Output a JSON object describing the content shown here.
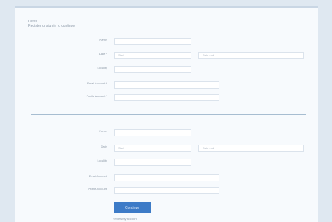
{
  "hint": {
    "line1": "Dates",
    "line2": "Register or sign in to continue"
  },
  "section1": {
    "labels": [
      "Name",
      "Date *",
      "Locality",
      "Email Account *",
      "Profile Account *"
    ],
    "date_start_placeholder": "Start",
    "date_end_placeholder": "Date end"
  },
  "section2": {
    "labels": [
      "Name",
      "Date",
      "Locality",
      "Email Account",
      "Profile Account"
    ],
    "date_start_placeholder": "Start",
    "date_end_placeholder": "Date end"
  },
  "continue_button": "Continue",
  "footer_text": "Review my account"
}
